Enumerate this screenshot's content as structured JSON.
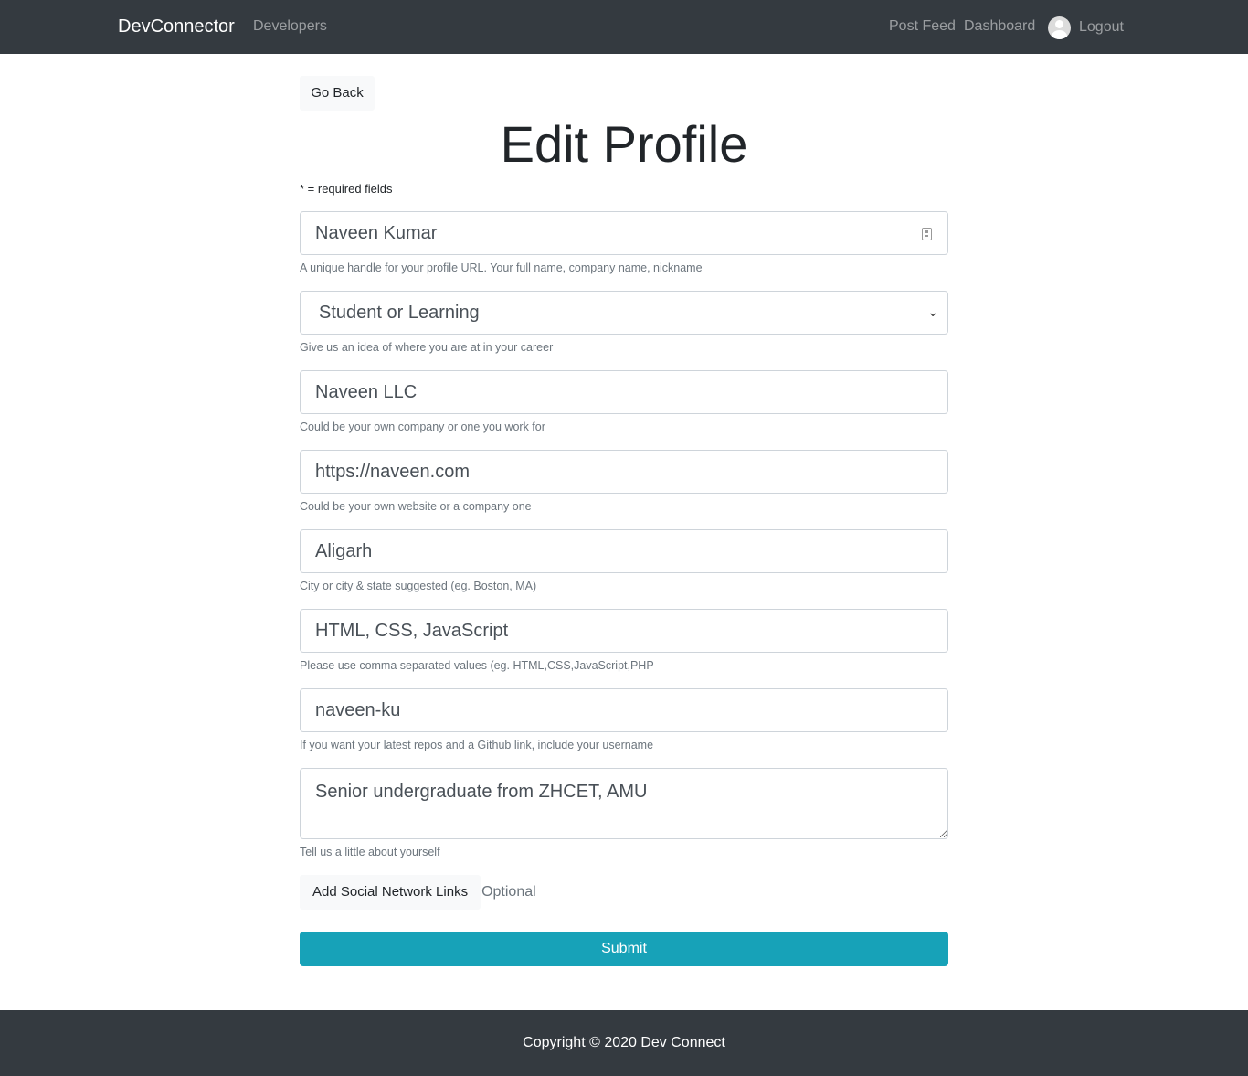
{
  "navbar": {
    "brand": "DevConnector",
    "developers": "Developers",
    "post_feed": "Post Feed",
    "dashboard": "Dashboard",
    "logout": "Logout"
  },
  "page": {
    "go_back": "Go Back",
    "title": "Edit Profile",
    "required_note": "* = required fields"
  },
  "form": {
    "handle": {
      "value": "Naveen Kumar",
      "help": "A unique handle for your profile URL. Your full name, company name, nickname"
    },
    "status": {
      "value": "Student or Learning",
      "help": "Give us an idea of where you are at in your career"
    },
    "company": {
      "value": "Naveen LLC",
      "help": "Could be your own company or one you work for"
    },
    "website": {
      "value": "https://naveen.com",
      "help": "Could be your own website or a company one"
    },
    "location": {
      "value": "Aligarh",
      "help": "City or city & state suggested (eg. Boston, MA)"
    },
    "skills": {
      "value": "HTML, CSS, JavaScript",
      "help": "Please use comma separated values (eg. HTML,CSS,JavaScript,PHP"
    },
    "github": {
      "value": "naveen-ku",
      "help": "If you want your latest repos and a Github link, include your username"
    },
    "bio": {
      "value": "Senior undergraduate from ZHCET, AMU",
      "help": "Tell us a little about yourself"
    },
    "social_button": "Add Social Network Links",
    "optional": "Optional",
    "submit": "Submit"
  },
  "footer": {
    "text": "Copyright © 2020 Dev Connect"
  },
  "colors": {
    "navbar": "#343a40",
    "accent": "#17a2b8"
  }
}
